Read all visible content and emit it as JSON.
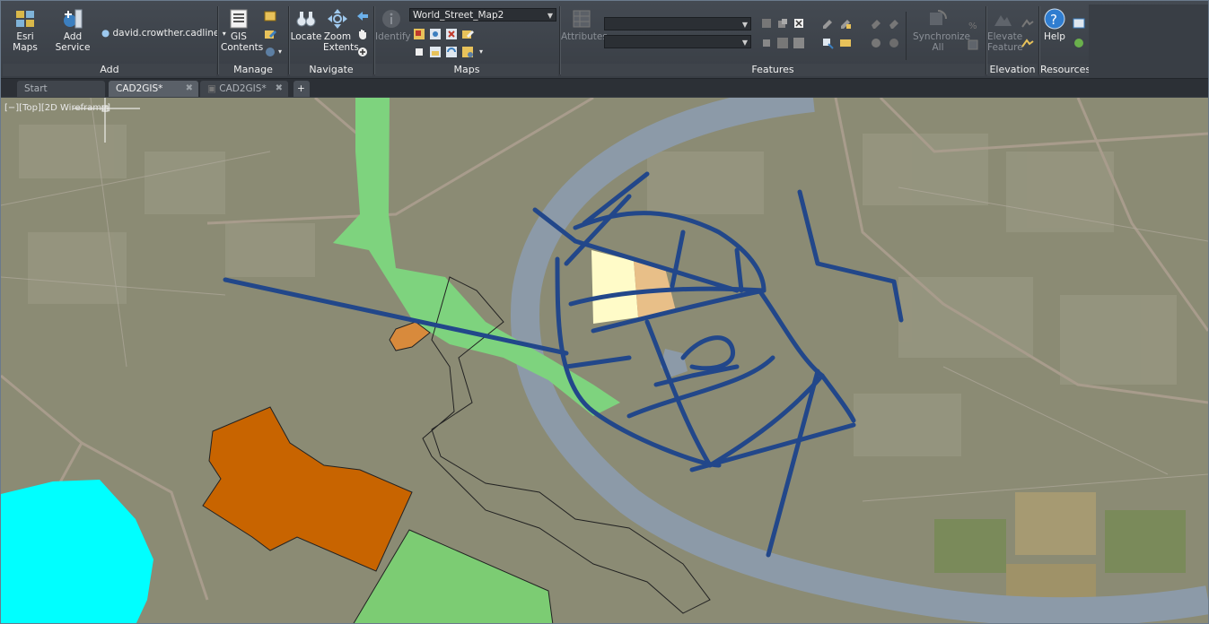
{
  "ribbon": {
    "add": {
      "title": "Add",
      "esri_maps": "Esri Maps",
      "add_service": "Add Service",
      "user": "david.crowther.cadline"
    },
    "manage": {
      "title": "Manage",
      "gis_contents": "GIS Contents"
    },
    "navigate": {
      "title": "Navigate",
      "locate": "Locate",
      "zoom_extents": "Zoom Extents"
    },
    "maps": {
      "title": "Maps",
      "identify": "Identify",
      "basemap": "World_Street_Map2"
    },
    "features": {
      "title": "Features",
      "attributes": "Attributes",
      "synchronize_all": "Synchronize All"
    },
    "elevation": {
      "title": "Elevation",
      "elevate_feature": "Elevate Feature"
    },
    "resources": {
      "title": "Resources",
      "help": "Help"
    }
  },
  "tabs": [
    {
      "label": "Start"
    },
    {
      "label": "CAD2GIS*"
    },
    {
      "label": "CAD2GIS*"
    }
  ],
  "viewport_label": "[−][Top][2D Wireframe]",
  "colors": {
    "ribbon_bg": "#3f444b",
    "map_bg": "#8b8b74",
    "river": "#8c9aa8",
    "route_lines": "#22478a",
    "green_area": "#7ed37e",
    "orange_parcel": "#c86400",
    "cyan_area": "#00ffff"
  }
}
